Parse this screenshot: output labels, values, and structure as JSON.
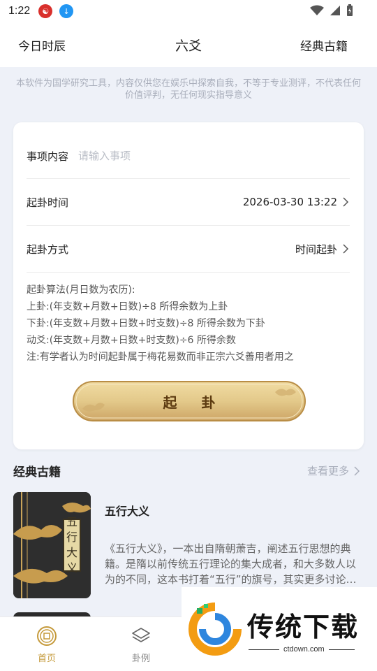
{
  "status_bar": {
    "time": "1:22"
  },
  "header": {
    "left_label": "今日时辰",
    "title": "六爻",
    "right_label": "经典古籍"
  },
  "disclaimer": {
    "line1": "本软件为国学研究工具，内容仅供您在娱乐中探索自我，不等于专业测评，不代表任何",
    "line2": "价值评判，无任何现实指导意义"
  },
  "form": {
    "matter_label": "事项内容",
    "matter_placeholder": "请输入事项",
    "matter_value": "",
    "time_label": "起卦时间",
    "time_value": "2026-03-30 13:22",
    "method_label": "起卦方式",
    "method_value": "时间起卦"
  },
  "algorithm": {
    "heading": "起卦算法(月日数为农历):",
    "upper": "上卦:(年支数+月数+日数)÷8 所得余数为上卦",
    "lower": "下卦:(年支数+月数+日数+时支数)÷8 所得余数为下卦",
    "moving": "动爻:(年支数+月数+日数+时支数)÷6 所得余数",
    "note": "注:有学者认为时间起卦属于梅花易数而非正宗六爻善用者用之"
  },
  "cast_button": "起 卦",
  "classics": {
    "section_title": "经典古籍",
    "more_label": "查看更多",
    "books": [
      {
        "name": "五行大义",
        "cover_title_chars": [
          "五",
          "行",
          "大",
          "义"
        ],
        "description": "《五行大义》，一本出自隋朝萧吉，阐述五行思想的典籍。是隋以前传统五行理论的集大成者，和大多数人以为的不同，这本书打着“五行”的旗号，其实更多讨论是..."
      }
    ]
  },
  "tabbar": {
    "tabs": [
      {
        "label": "首页",
        "icon": "coin-icon",
        "active": true
      },
      {
        "label": "卦例",
        "icon": "layers-icon",
        "active": false
      }
    ]
  },
  "watermark": {
    "brand": "传统下载",
    "url": "ctdown.com"
  },
  "colors": {
    "accent_gold": "#c59a3b",
    "background": "#eef1f8",
    "button_gold": "#e3c98a"
  }
}
